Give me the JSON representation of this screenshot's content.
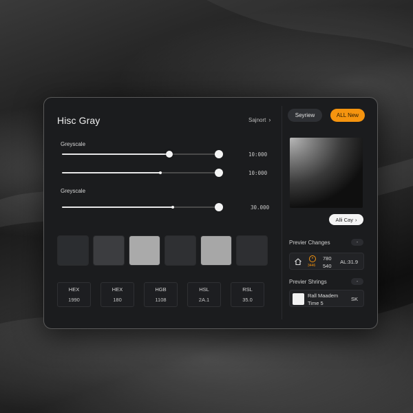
{
  "window": {
    "title": "Hisc Gray",
    "support_link": "Sajnort"
  },
  "controls": {
    "group1_label": "Greyscale",
    "group2_label": "Greyscale",
    "sliders": [
      {
        "level": 0.68,
        "value": "10:000"
      },
      {
        "level": 0.62,
        "value": "10:000"
      },
      {
        "level": 0.7,
        "value": "30.000"
      }
    ]
  },
  "swatches": [
    {
      "name": "swatch-1",
      "color": "#2b2d30"
    },
    {
      "name": "swatch-2",
      "color": "#3c3d40"
    },
    {
      "name": "swatch-3",
      "color": "#aaaaaa"
    },
    {
      "name": "swatch-4",
      "color": "#2f3033"
    },
    {
      "name": "swatch-5",
      "color": "#a7a7a7"
    },
    {
      "name": "swatch-6",
      "color": "#2e2f32"
    }
  ],
  "codes": [
    {
      "label": "HEX",
      "value": "1990"
    },
    {
      "label": "HEX",
      "value": "180"
    },
    {
      "label": "HGB",
      "value": "1108"
    },
    {
      "label": "HSL",
      "value": "2A.1"
    },
    {
      "label": "RSL",
      "value": "35.0"
    }
  ],
  "right_panel": {
    "preview_button": "Seyriew",
    "new_button": "ALL New",
    "all_gray_button": "Alli Cay",
    "changes_label": "Previer Changes",
    "strings_label": "Previer Shrings",
    "toggle_symbol": "-",
    "changes_row": {
      "badge_caption": "3446",
      "num_top": "780",
      "num_bottom": "540",
      "right_text": "AL:31.9"
    },
    "strings_row": {
      "line1": "Rall Maadem",
      "line2": "Time 5",
      "right_text": "SK"
    }
  },
  "colors": {
    "accent": "#f5940f",
    "panel_bg": "#1b1c1e"
  }
}
